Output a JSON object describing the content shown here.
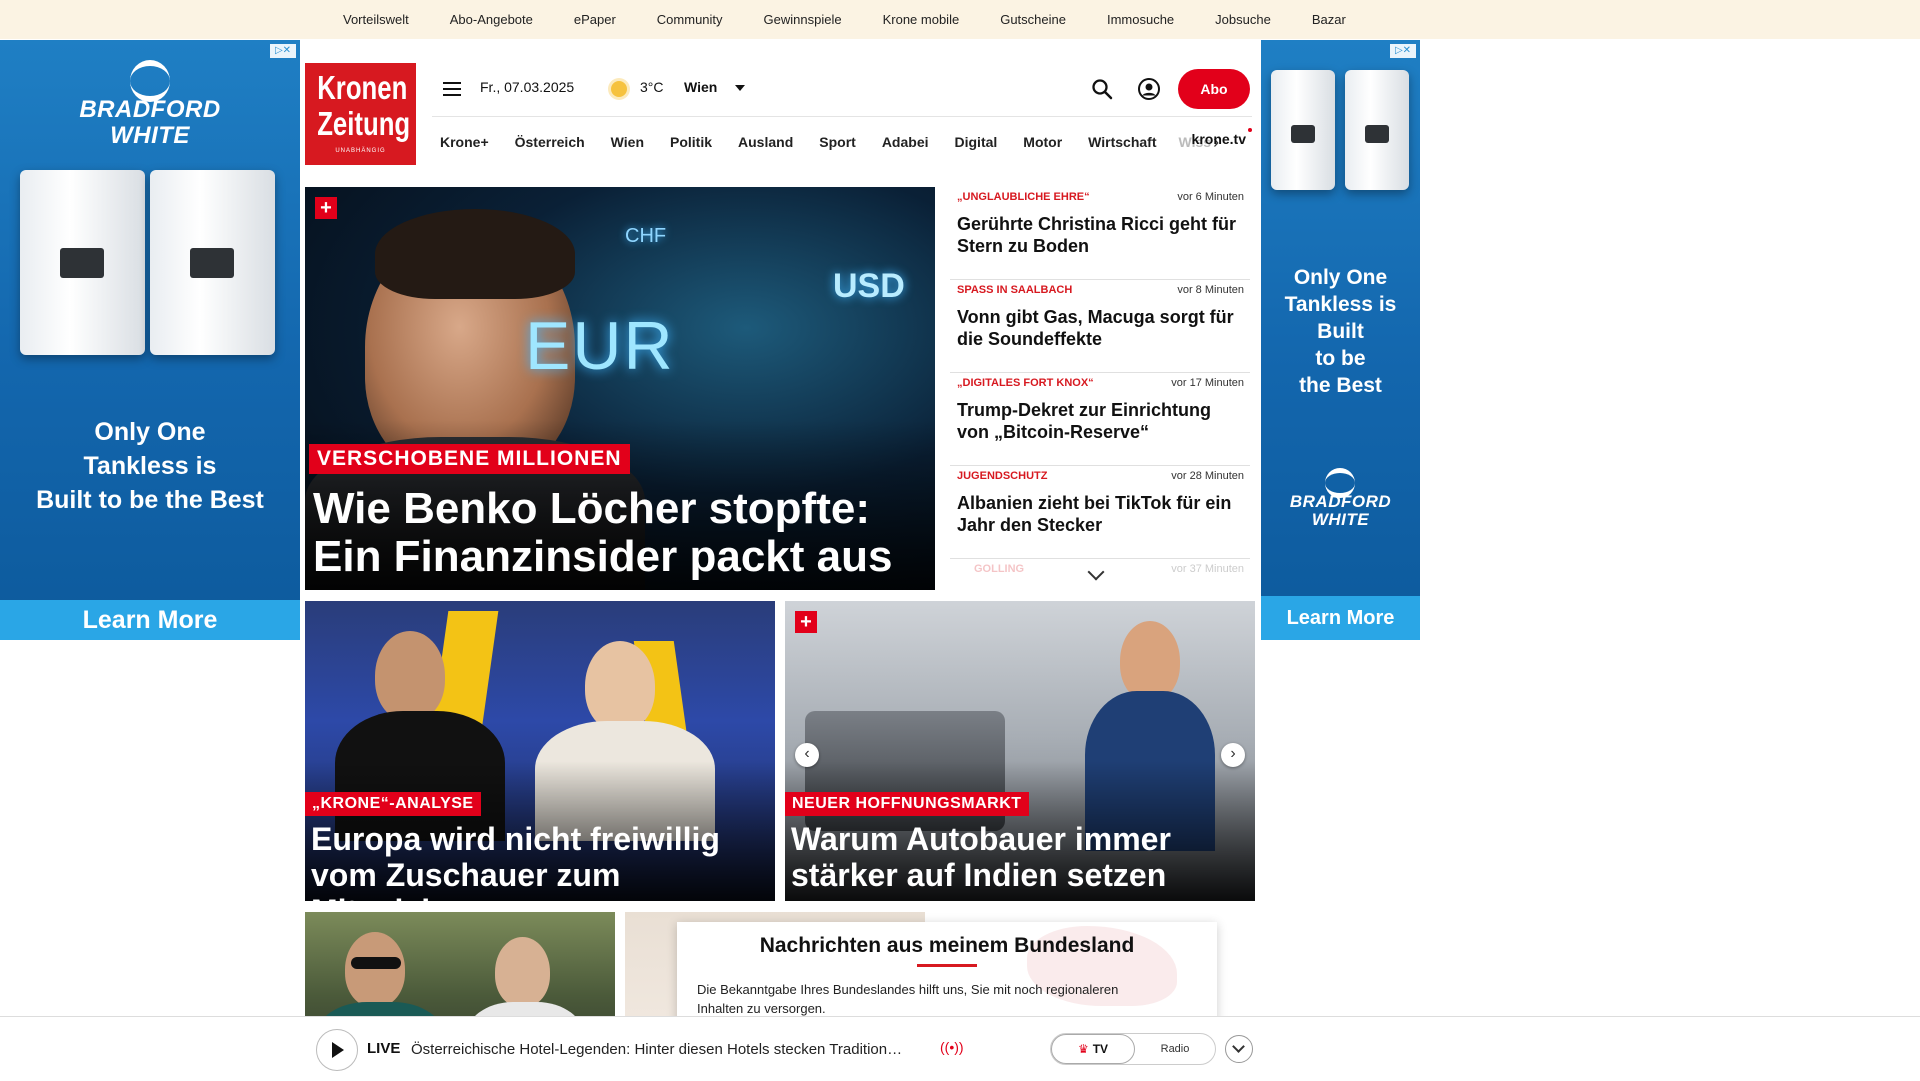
{
  "topbar": {
    "links": [
      "Vorteilswelt",
      "Abo-Angebote",
      "ePaper",
      "Community",
      "Gewinnspiele",
      "Krone mobile",
      "Gutscheine",
      "Immosuche",
      "Jobsuche",
      "Bazar"
    ]
  },
  "ads": {
    "left": {
      "brand_1": "BRADFORD",
      "brand_2": "WHITE",
      "tag_1": "Only One",
      "tag_2": "Tankless is",
      "tag_3": "Built to be the Best",
      "cta": "Learn More"
    },
    "right": {
      "tag_1": "Only One",
      "tag_2": "Tankless is",
      "tag_3": "Built",
      "tag_4": "to be",
      "tag_5": "the Best",
      "brand_1": "BRADFORD",
      "brand_2": "WHITE",
      "cta": "Learn More"
    },
    "adchoice": "▷✕"
  },
  "header": {
    "logo_line1": "Kronen",
    "logo_line2": "Zeitung",
    "logo_tagline": "UNABHÄNGIG",
    "date": "Fr., 07.03.2025",
    "temperature": "3°C",
    "city": "Wien",
    "abo_label": "Abo",
    "colors": {
      "brand_red": "#e2001a"
    }
  },
  "nav": {
    "items": [
      "Krone+",
      "Österreich",
      "Wien",
      "Politik",
      "Ausland",
      "Sport",
      "Adabei",
      "Digital",
      "Motor",
      "Wirtschaft"
    ],
    "faded": "Wiss",
    "arrow": "›",
    "tv": "krone.tv"
  },
  "hero": {
    "kicker": "VERSCHOBENE MILLIONEN",
    "title_line1": "Wie Benko Löcher stopfte:",
    "title_line2": "Ein Finanzinsider packt aus",
    "img_eur": "EUR",
    "img_usd": "USD",
    "img_chf": "CHF",
    "plus": "+"
  },
  "ticker": {
    "items": [
      {
        "kicker": "„UNGLAUBLICHE EHRE“",
        "time": "vor 6 Minuten",
        "title": "Gerührte Christina Ricci geht für Stern zu Boden"
      },
      {
        "kicker": "SPASS IN SAALBACH",
        "time": "vor 8 Minuten",
        "title": "Vonn gibt Gas, Macuga sorgt für die Soundeffekte"
      },
      {
        "kicker": "„DIGITALES FORT KNOX“",
        "time": "vor 17 Minuten",
        "title": "Trump-Dekret zur Einrichtung von „Bitcoin-Reserve“"
      },
      {
        "kicker": "JUGENDSCHUTZ",
        "time": "vor 28 Minuten",
        "title": "Albanien zieht bei TikTok für ein Jahr den Stecker"
      }
    ],
    "faded_kicker": "GOLLING",
    "faded_time": "vor 37 Minuten"
  },
  "cards": [
    {
      "kicker": "„KRONE“-ANALYSE",
      "title_line1": "Europa wird nicht freiwillig",
      "title_line2": "vom Zuschauer zum Mitspieler"
    },
    {
      "kicker": "NEUER HOFFNUNGSMARKT",
      "title_line1": "Warum Autobauer immer",
      "title_line2": "stärker auf Indien setzen",
      "plus": "+",
      "prev": "‹",
      "next": "›"
    }
  ],
  "popup": {
    "title": "Nachrichten aus meinem Bundesland",
    "text": "Die Bekanntgabe Ihres Bundeslandes hilft uns, Sie mit noch regionaleren Inhalten zu versorgen."
  },
  "live": {
    "label": "LIVE",
    "text": "Österreichische Hotel-Legenden: Hinter diesen Hotels stecken Tradition…",
    "signal": "((•))",
    "tv_label": "TV",
    "radio_label": "Radio"
  }
}
